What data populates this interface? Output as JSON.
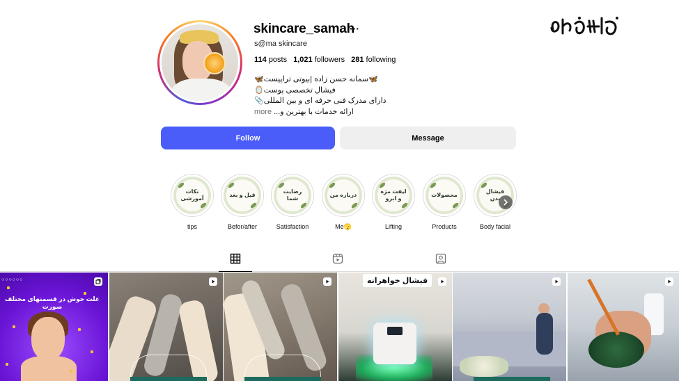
{
  "watermark": {
    "text": "پارس ترون"
  },
  "profile": {
    "username": "skincare_samah",
    "more": "···",
    "full_name": "s@ma skincare",
    "stats": {
      "posts_count": "114",
      "posts_label": "posts",
      "followers_count": "1,021",
      "followers_label": "followers",
      "following_count": "281",
      "following_label": "following"
    },
    "bio": {
      "line1": "🦋سمانه حسن زاده |بیوتی تراپیست🦋",
      "line2": "فیشال تخصصی پوست🪞",
      "line3": "دارای مدرک فنی حرفه ای و بین المللی📎",
      "line4": "ارائه خدمات با بهترین و...",
      "more": "more"
    }
  },
  "buttons": {
    "follow": "Follow",
    "message": "Message"
  },
  "highlights": [
    {
      "label": "tips",
      "cover": "نکات آموزشی"
    },
    {
      "label": "Befor/after",
      "cover": "قبل و بعد"
    },
    {
      "label": "Satisfaction",
      "cover": "رضایت شما"
    },
    {
      "label": "Me🫣",
      "cover": "درباره من"
    },
    {
      "label": "Lifting",
      "cover": "لیفت مژه و ابرو"
    },
    {
      "label": "Products",
      "cover": "محصولات"
    },
    {
      "label": "Body facial",
      "cover": "فیشال بدن"
    }
  ],
  "tabs": [
    {
      "name": "posts",
      "icon": "grid-icon"
    },
    {
      "name": "reels",
      "icon": "reels-icon"
    },
    {
      "name": "tagged",
      "icon": "tagged-icon"
    }
  ],
  "posts": [
    {
      "caption": "علت جوش در قسمتهای مختلف صورت",
      "type": "carousel"
    },
    {
      "caption": "",
      "type": "reel"
    },
    {
      "caption": "",
      "type": "reel"
    },
    {
      "caption": "فیشال خواهرانه",
      "type": "reel"
    },
    {
      "caption": "",
      "type": "reel"
    },
    {
      "caption": "",
      "type": "reel"
    }
  ],
  "colors": {
    "follow_button": "#4a5df9",
    "message_button": "#efefef"
  }
}
